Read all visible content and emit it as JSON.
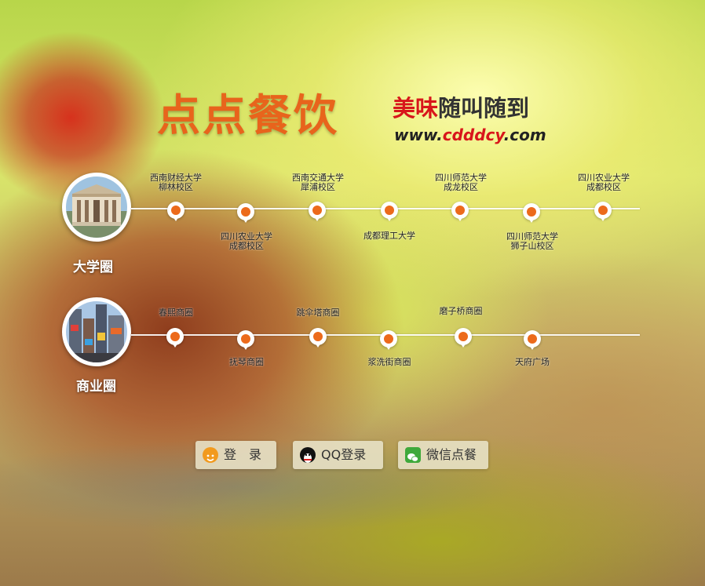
{
  "logo": {
    "title": "点点餐饮",
    "slogan_red": "美味",
    "slogan_rest": "随叫随到",
    "url_pre": "www.",
    "url_red": "cdddcy",
    "url_post": ".com"
  },
  "university": {
    "label": "大学圈",
    "top_items": [
      {
        "line1": "西南财经大学",
        "line2": "柳林校区"
      },
      {
        "line1": "西南交通大学",
        "line2": "犀浦校区"
      },
      {
        "line1": "四川师范大学",
        "line2": "成龙校区"
      },
      {
        "line1": "四川农业大学",
        "line2": "成都校区"
      }
    ],
    "bottom_items": [
      {
        "line1": "四川农业大学",
        "line2": "成都校区"
      },
      {
        "line1": "成都理工大学",
        "line2": ""
      },
      {
        "line1": "四川师范大学",
        "line2": "狮子山校区"
      }
    ]
  },
  "business": {
    "label": "商业圈",
    "top_items": [
      "春熙商圈",
      "跳伞塔商圈",
      "磨子桥商圈"
    ],
    "bottom_items": [
      "抚琴商圈",
      "浆洗街商圈",
      "天府广场"
    ]
  },
  "buttons": {
    "login": "登　录",
    "qq_login": "QQ登录",
    "wechat": "微信点餐"
  },
  "colors": {
    "accent": "#ec6a1b",
    "logo": "#e8641c",
    "slogan_red": "#d8161b"
  }
}
